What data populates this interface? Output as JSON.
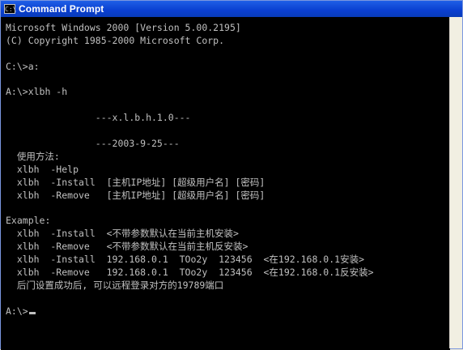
{
  "window": {
    "title": "Command Prompt",
    "icon": "cmd-icon"
  },
  "console": {
    "lines": [
      "Microsoft Windows 2000 [Version 5.00.2195]",
      "(C) Copyright 1985-2000 Microsoft Corp.",
      "",
      "C:\\>a:",
      "",
      "A:\\>xlbh -h",
      "",
      "                ---x.l.b.h.1.0---",
      "",
      "                ---2003-9-25---",
      "  使用方法:",
      "  xlbh  -Help",
      "  xlbh  -Install  [主机IP地址] [超级用户名] [密码]",
      "  xlbh  -Remove   [主机IP地址] [超级用户名] [密码]",
      "",
      "Example:",
      "  xlbh  -Install  <不带参数默认在当前主机安装>",
      "  xlbh  -Remove   <不带参数默认在当前主机反安装>",
      "  xlbh  -Install  192.168.0.1  TOo2y  123456  <在192.168.0.1安装>",
      "  xlbh  -Remove   192.168.0.1  TOo2y  123456  <在192.168.0.1反安装>",
      "  后门设置成功后, 可以远程登录对方的19789端口",
      "",
      "A:\\>"
    ]
  }
}
